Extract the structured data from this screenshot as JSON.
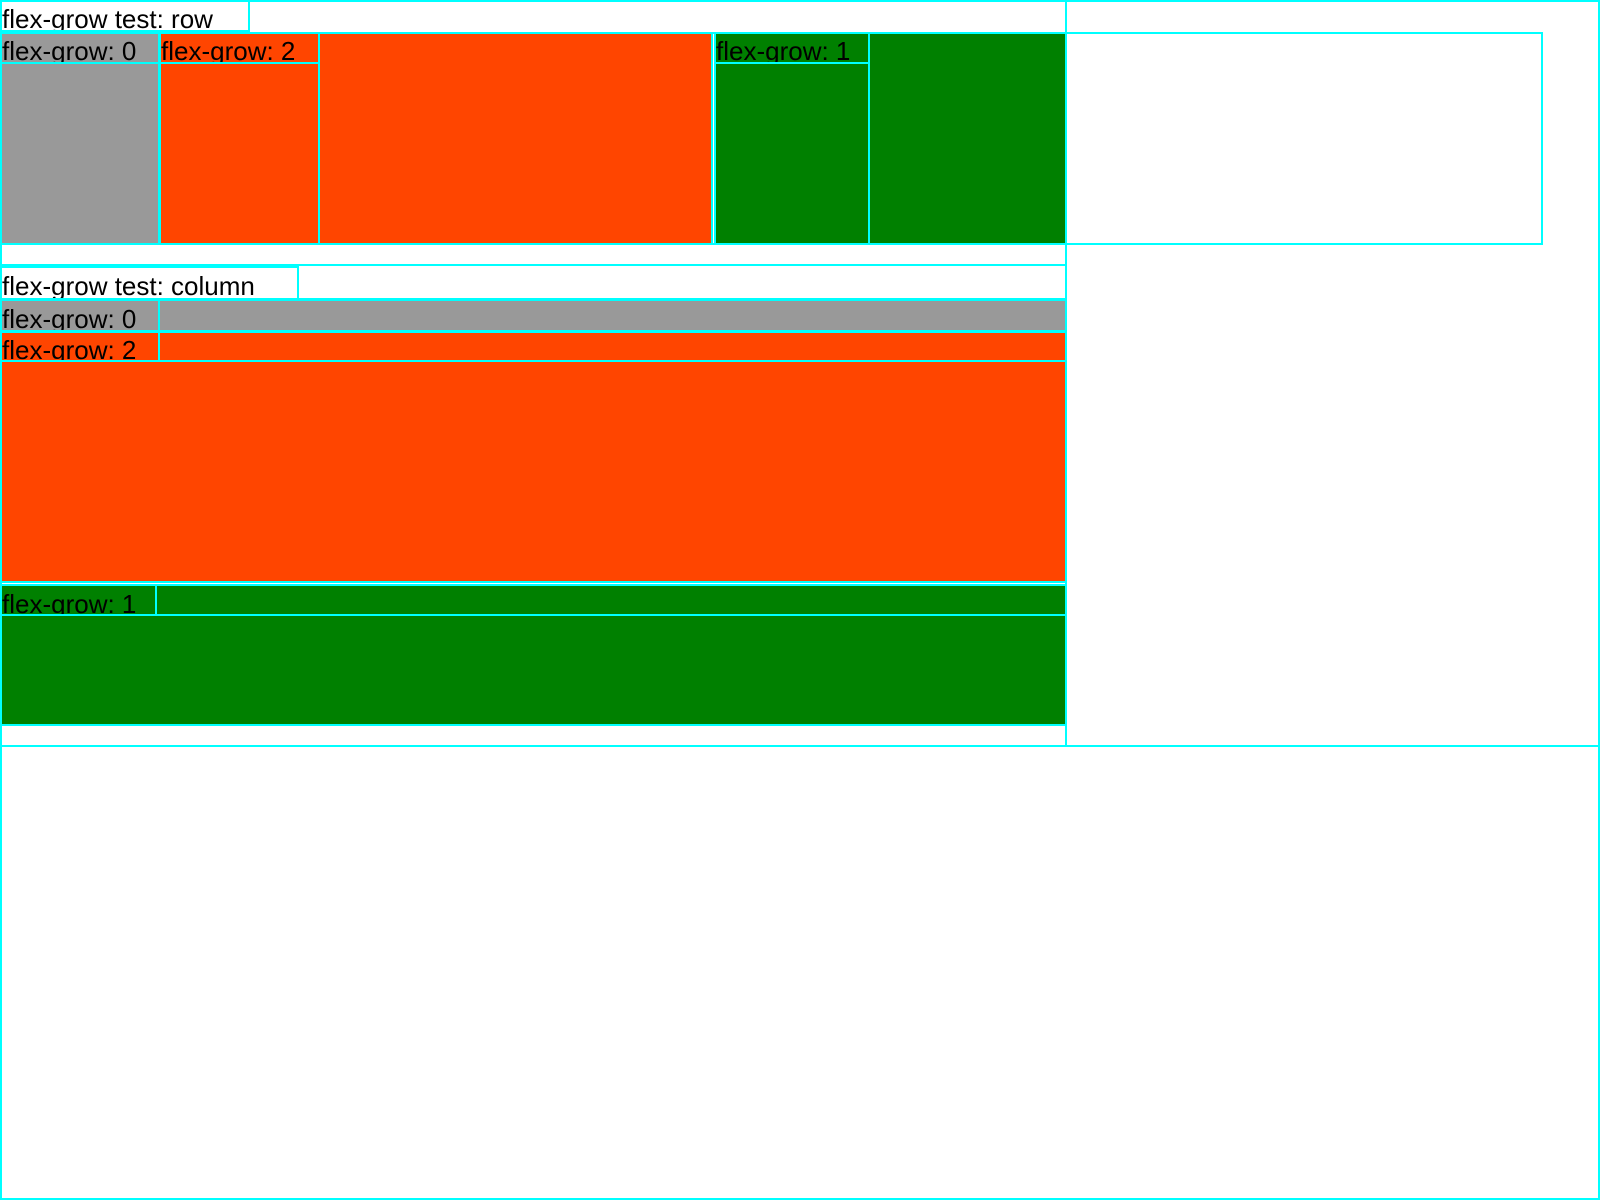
{
  "row_test": {
    "title": "flex-grow test: row",
    "items": [
      {
        "label": "flex-grow: 0",
        "color": "#999999"
      },
      {
        "label": "flex-grow: 2",
        "color": "#ff4500"
      },
      {
        "label": "flex-grow: 1",
        "color": "#008000"
      }
    ]
  },
  "column_test": {
    "title": "flex-grow test: column",
    "items": [
      {
        "label": "flex-grow: 0",
        "color": "#999999"
      },
      {
        "label": "flex-grow: 2",
        "color": "#ff4500"
      },
      {
        "label": "flex-grow: 1",
        "color": "#008000"
      }
    ]
  },
  "colors": {
    "outline": "#00ffff",
    "gray": "#999999",
    "orange": "#ff4500",
    "green": "#008000"
  }
}
